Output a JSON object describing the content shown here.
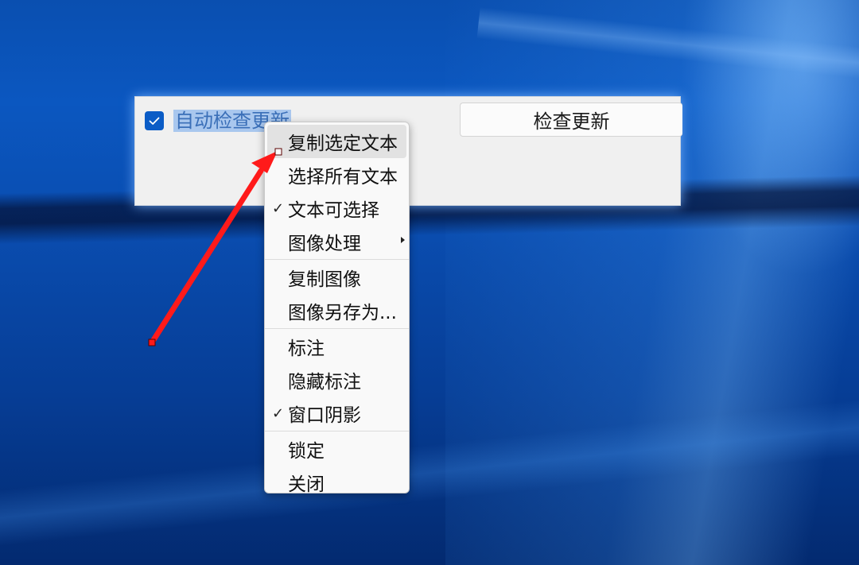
{
  "panel": {
    "checkbox_label": "自动检查更新",
    "checkbox_checked": true,
    "check_button_label": "检查更新"
  },
  "context_menu": {
    "items": [
      {
        "label": "复制选定文本",
        "checked": false,
        "submenu": false,
        "highlighted": true
      },
      {
        "label": "选择所有文本",
        "checked": false,
        "submenu": false
      },
      {
        "label": "文本可选择",
        "checked": true,
        "submenu": false
      },
      {
        "label": "图像处理",
        "checked": false,
        "submenu": true
      },
      {
        "label": "复制图像",
        "checked": false,
        "submenu": false
      },
      {
        "label": "图像另存为...",
        "checked": false,
        "submenu": false
      },
      {
        "label": "标注",
        "checked": false,
        "submenu": false
      },
      {
        "label": "隐藏标注",
        "checked": false,
        "submenu": false
      },
      {
        "label": "窗口阴影",
        "checked": true,
        "submenu": false
      },
      {
        "label": "锁定",
        "checked": false,
        "submenu": false
      },
      {
        "label": "关闭",
        "checked": false,
        "submenu": false
      }
    ],
    "check_glyph": "✓"
  },
  "annotation": {
    "color": "#ff1a1a",
    "type": "arrow"
  },
  "colors": {
    "accent": "#0b5cc6",
    "selection": "#a9c7ee",
    "desktop": "#0a4fb0"
  }
}
